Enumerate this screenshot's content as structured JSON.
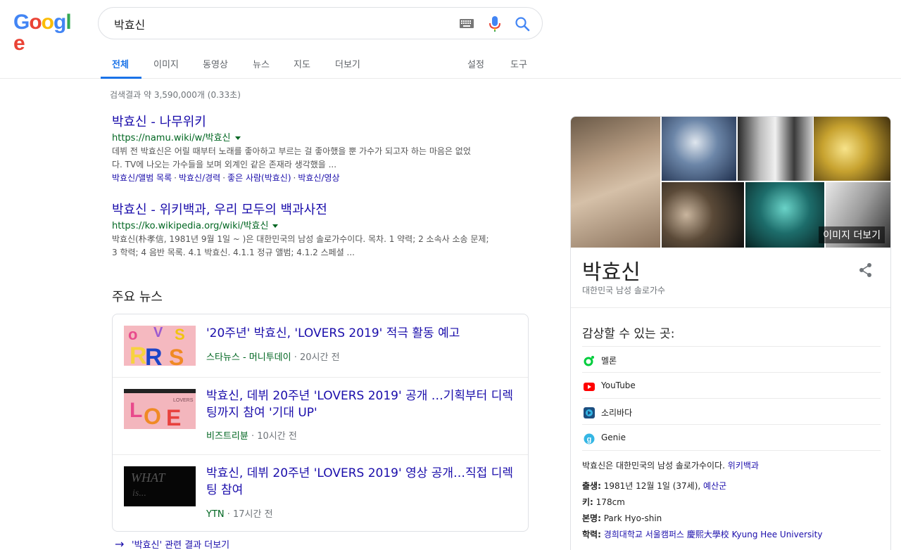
{
  "logo": {
    "letters": [
      "G",
      "o",
      "o",
      "g",
      "l",
      "e"
    ]
  },
  "search": {
    "query": "박효신"
  },
  "tabs": [
    "전체",
    "이미지",
    "동영상",
    "뉴스",
    "지도",
    "더보기",
    "설정",
    "도구"
  ],
  "result_stats": "검색결과 약 3,590,000개 (0.33초)",
  "results": [
    {
      "title": "박효신 - 나무위키",
      "url": "https://namu.wiki/w/박효신",
      "snippet_lines": [
        "데뷔 전 박효신은 어릴 때부터 노래를 좋아하고 부르는 걸 좋아했을 뿐 가수가 되고자 하는 마음은 없었",
        "다. TV에 나오는 가수들을 보며 외계인 같은 존재라 생각했을 ..."
      ],
      "sitelinks": [
        "박효신/앨범 목록",
        "박효신/경력",
        "좋은 사람(박효신)",
        "박효신/영상"
      ]
    },
    {
      "title": "박효신 - 위키백과, 우리 모두의 백과사전",
      "url": "https://ko.wikipedia.org/wiki/박효신",
      "snippet_lines": [
        "박효신(朴孝信, 1981년 9월 1일 ~ )은 대한민국의 남성 솔로가수이다. 목차. 1 약력; 2 소속사 소송 문제;",
        "3 학력; 4 음반 목록. 4.1 박효신. 4.1.1 정규 앨범; 4.1.2 스페셜 ..."
      ]
    }
  ],
  "news": {
    "heading": "주요 뉴스",
    "items": [
      {
        "title": "'20주년' 박효신, 'LOVERS 2019' 적극 활동 예고",
        "source": "스타뉴스 - 머니투데이",
        "time": "20시간 전"
      },
      {
        "title": "박효신, 데뷔 20주년 'LOVERS 2019' 공개 …기획부터 디렉팅까지 참여 '기대 UP'",
        "source": "비즈트리뷴",
        "time": "10시간 전"
      },
      {
        "title": "박효신, 데뷔 20주년 'LOVERS 2019' 영상 공개…직접 디렉팅 참여",
        "source": "YTN",
        "time": "17시간 전"
      }
    ],
    "more": "'박효신' 관련 결과 더보기"
  },
  "knowledge_panel": {
    "more_images": "이미지 더보기",
    "title": "박효신",
    "subtitle": "대한민국 남성 솔로가수",
    "listen_heading": "감상할 수 있는 곳:",
    "services": [
      {
        "name": "멜론",
        "color": "#00cd3c"
      },
      {
        "name": "YouTube",
        "color": "#ff0000"
      },
      {
        "name": "소리바다",
        "color": "#1c4e80"
      },
      {
        "name": "Genie",
        "color": "#34b6e4"
      }
    ],
    "description": "박효신은 대한민국의 남성 솔로가수이다.",
    "description_link": "위키백과",
    "facts": [
      {
        "label": "출생:",
        "value": "1981년 12월 1일 (37세),",
        "link": "예산군"
      },
      {
        "label": "키:",
        "value": "178cm",
        "link": ""
      },
      {
        "label": "본명:",
        "value": "Park Hyo-shin",
        "link": ""
      },
      {
        "label": "학력:",
        "value": "",
        "link": "경희대학교 서울캠퍼스 慶熙大學校 Kyung Hee University"
      }
    ]
  }
}
